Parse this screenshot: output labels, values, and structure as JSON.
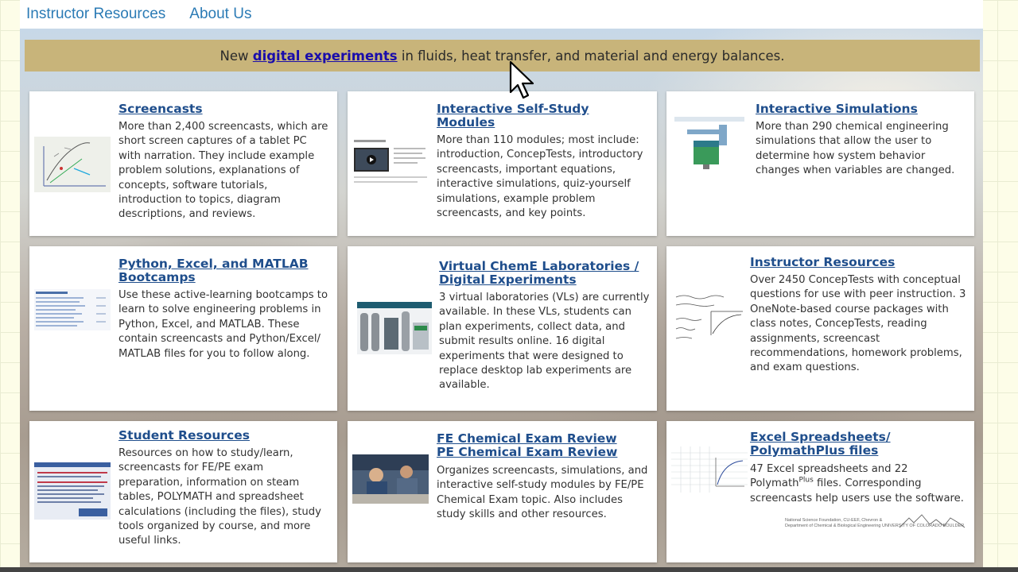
{
  "nav": {
    "items": [
      "Instructor Resources",
      "About Us"
    ]
  },
  "announcement": {
    "prefix": "New ",
    "link": "digital experiments",
    "suffix": " in fluids, heat transfer, and material and energy balances."
  },
  "cards": [
    {
      "title": "Screencasts",
      "text": "More than 2,400 screencasts, which are short screen captures of a tablet PC with narration. They include example problem solutions, explanations of concepts, software tutorials, introduction to topics, diagram descriptions, and reviews."
    },
    {
      "title": "Interactive Self-Study Modules",
      "text": "More than 110 modules; most include: introduction, ConcepTests, introductory screencasts, important equations, interactive simulations, quiz-yourself simulations, example problem screencasts, and key points."
    },
    {
      "title": "Interactive Simulations",
      "text": "More than 290 chemical engineering simulations that allow the user to determine how system behavior changes when variables are changed."
    },
    {
      "title": "Python, Excel, and MATLAB Bootcamps",
      "text": "Use these active-learning bootcamps to learn to solve engineering problems in Python, Excel, and MATLAB. These contain screencasts and Python/Excel/ MATLAB files for you to follow along."
    },
    {
      "title": "Virtual ChemE Laboratories / Digital Experiments",
      "text": "3 virtual laboratories (VLs) are currently available. In these VLs, students can plan experiments, collect data, and submit results online. 16 digital experiments that were designed to replace desktop lab experiments are available."
    },
    {
      "title": "Instructor Resources",
      "text": "Over 2450 ConcepTests with conceptual questions for use with peer instruction. 3 OneNote-based course packages with class notes, ConcepTests, reading assignments, screencast recommendations, homework problems, and exam questions."
    },
    {
      "title": "Student Resources",
      "text": "Resources on how to study/learn, screencasts for FE/PE exam preparation, information on steam tables, POLYMATH and spreadsheet calculations (including the files), study tools organized by course, and more useful links."
    },
    {
      "title": "FE Chemical Exam Review",
      "title2": "PE Chemical Exam Review",
      "text": "Organizes screencasts, simulations, and interactive self-study modules by FE/PE Chemical Exam topic. Also includes study skills and other resources."
    },
    {
      "title": "Excel Spreadsheets/ PolymathPlus files",
      "text_pre": "47 Excel spreadsheets and 22 Polymath",
      "text_sup": "Plus",
      "text_post": " files. Corresponding screencasts help users use the software."
    }
  ],
  "credit": {
    "line1": "National Science Foundation, CU-EEF, Chevron &",
    "line2": "Department of Chemical & Biological Engineering",
    "univ": "UNIVERSITY OF COLORADO BOULDER"
  },
  "colors": {
    "nav_link": "#2b7bb5",
    "title_link": "#1f4e8c",
    "announce_bg": "#c8b47a"
  }
}
